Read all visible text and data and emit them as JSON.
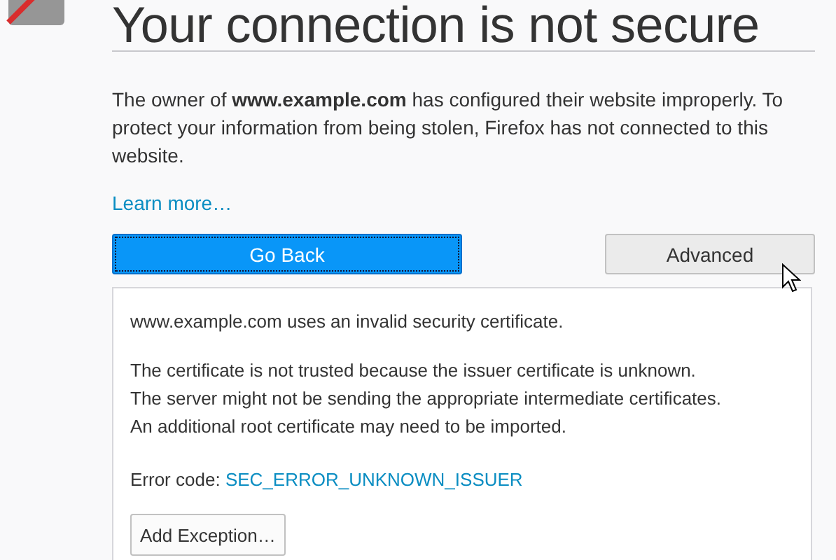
{
  "title": "Your connection is not secure",
  "description": "The owner of **www.example.com** has configured their website improperly. To protect your information from being stolen, Firefox has not connected to this website.",
  "learn_more": "Learn more…",
  "buttons": [
    {
      "label": "Go Back",
      "kind": "primary"
    },
    {
      "label": "Advanced",
      "kind": "secondary"
    }
  ],
  "advanced_panel": {
    "summary": "www.example.com uses an invalid security certificate.",
    "details": [
      "The certificate is not trusted because the issuer certificate is unknown.",
      "The server might not be sending the appropriate intermediate certificates.",
      "An additional root certificate may need to be imported."
    ],
    "error_label": "Error code:",
    "error_code": "SEC_ERROR_UNKNOWN_ISSUER",
    "button": "Add Exception…"
  }
}
